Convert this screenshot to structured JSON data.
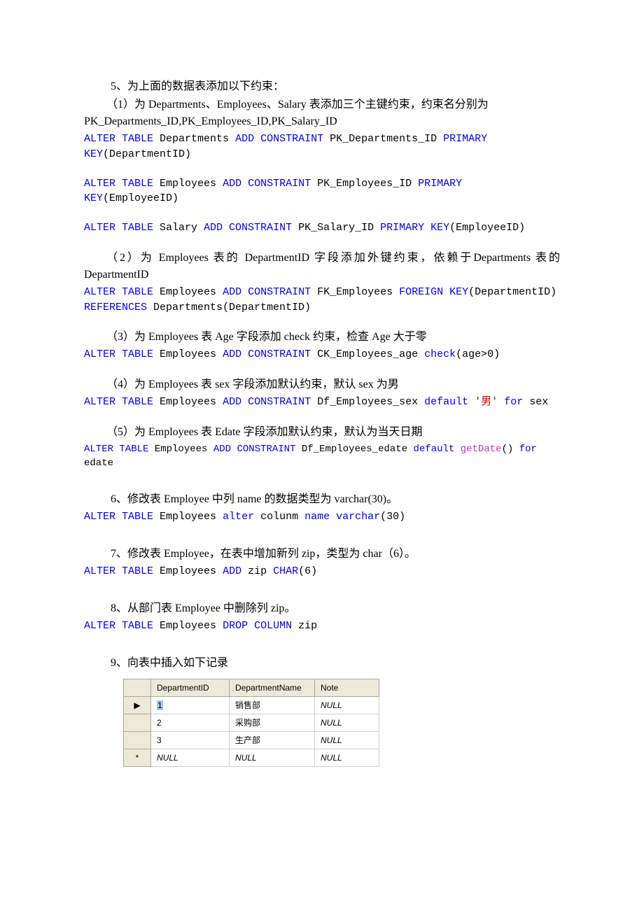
{
  "q5": {
    "heading": "5、为上面的数据表添加以下约束：",
    "s1": {
      "text": "（1）为 Departments、Employees、Salary 表添加三个主键约束，约束名分别为 PK_Departments_ID,PK_Employees_ID,PK_Salary_ID",
      "code1a": "ALTER TABLE",
      "code1b": " Departments ",
      "code1c": "ADD CONSTRAINT",
      "code1d": " PK_Departments_ID ",
      "code1e": "PRIMARY KEY",
      "code1f": "(DepartmentID)",
      "code2a": "ALTER TABLE",
      "code2b": " Employees ",
      "code2c": "ADD CONSTRAINT",
      "code2d": " PK_Employees_ID ",
      "code2e": "PRIMARY KEY",
      "code2f": "(EmployeeID)",
      "code3a": "ALTER TABLE",
      "code3b": " Salary ",
      "code3c": "ADD CONSTRAINT",
      "code3d": " PK_Salary_ID ",
      "code3e": "PRIMARY KEY",
      "code3f": "(EmployeeID)"
    },
    "s2": {
      "text": "（2）为 Employees 表的 DepartmentID 字段添加外键约束，依赖于Departments 表的 DepartmentID",
      "c1": "ALTER TABLE",
      "c2": " Employees ",
      "c3": "ADD CONSTRAINT",
      "c4": " FK_Employees ",
      "c5": "FOREIGN KEY",
      "c6": "(DepartmentID) ",
      "c7": "REFERENCES",
      "c8": " Departments(DepartmentID)"
    },
    "s3": {
      "text": "（3）为 Employees 表 Age 字段添加 check 约束，检查 Age 大于零",
      "c1": "ALTER TABLE",
      "c2": " Employees ",
      "c3": "ADD CONSTRAINT",
      "c4": " CK_Employees_age ",
      "c5": "check",
      "c6": "(age>0)"
    },
    "s4": {
      "text": "（4）为 Employees 表 sex 字段添加默认约束，默认 sex 为男",
      "c1": "ALTER TABLE",
      "c2": " Employees ",
      "c3": "ADD CONSTRAINT",
      "c4": " Df_Employees_sex ",
      "c5": "default",
      "c6": " ",
      "c7": "'男'",
      "c8": " ",
      "c9": "for",
      "c10": " sex"
    },
    "s5": {
      "text": "（5）为 Employees 表 Edate 字段添加默认约束，默认为当天日期",
      "c1": "ALTER TABLE",
      "c2": " Employees ",
      "c3": "ADD CONSTRAINT",
      "c4": " Df_Employees_edate ",
      "c5": "default",
      "c6": " ",
      "c7": "getDate",
      "c8": "() ",
      "c9": "for",
      "c10": " edate"
    }
  },
  "q6": {
    "heading": "6、修改表 Employee 中列 name 的数据类型为 varchar(30)。",
    "c1": "ALTER TABLE",
    "c2": " Employees ",
    "c3": "alter",
    "c4": " colunm ",
    "c5": "name varchar",
    "c6": "(30)"
  },
  "q7": {
    "heading": "7、修改表 Employee，在表中增加新列 zip，类型为 char（6）。",
    "c1": "ALTER TABLE",
    "c2": " Employees ",
    "c3": "ADD",
    "c4": " zip ",
    "c5": "CHAR",
    "c6": "(6)"
  },
  "q8": {
    "heading": "8、从部门表 Employee 中删除列 zip。",
    "c1": "ALTER TABLE",
    "c2": " Employees ",
    "c3": "DROP COLUMN",
    "c4": " zip"
  },
  "q9": {
    "heading": "9、向表中插入如下记录"
  },
  "table": {
    "headers": [
      "",
      "DepartmentID",
      "DepartmentName",
      "Note"
    ],
    "rows": [
      {
        "sel": "▶",
        "id": "1",
        "idSel": true,
        "name": "销售部",
        "note": "NULL"
      },
      {
        "sel": "",
        "id": "2",
        "idSel": false,
        "name": "采购部",
        "note": "NULL"
      },
      {
        "sel": "",
        "id": "3",
        "idSel": false,
        "name": "生产部",
        "note": "NULL"
      },
      {
        "sel": "*",
        "id": "NULL",
        "idSel": false,
        "name": "NULL",
        "note": "NULL"
      }
    ]
  }
}
